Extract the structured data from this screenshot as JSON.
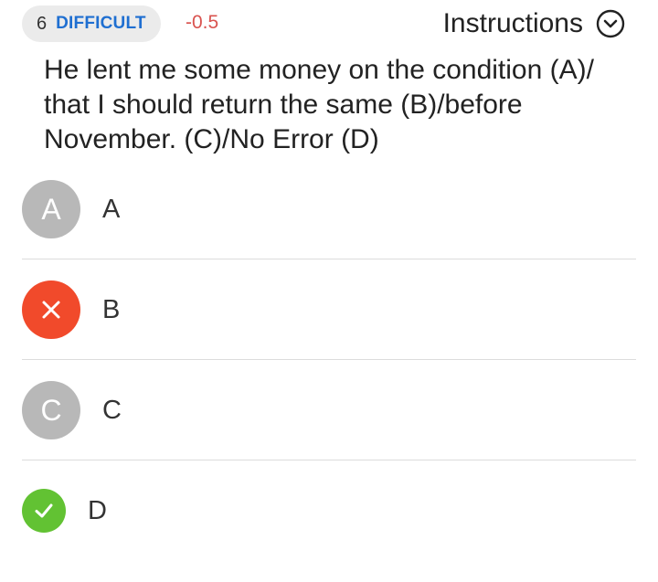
{
  "header": {
    "question_number": "6",
    "difficulty": "DIFFICULT",
    "penalty": "-0.5",
    "instructions_label": "Instructions"
  },
  "question": {
    "text": "He lent me some money on the condition (A)/ that I should return the same (B)/before November. (C)/No Error (D)"
  },
  "options": [
    {
      "badge": "A",
      "label": "A",
      "state": "unselected",
      "icon": "letter"
    },
    {
      "badge": "",
      "label": "B",
      "state": "wrong",
      "icon": "close-icon"
    },
    {
      "badge": "C",
      "label": "C",
      "state": "unselected",
      "icon": "letter"
    },
    {
      "badge": "",
      "label": "D",
      "state": "correct",
      "icon": "check-icon"
    }
  ],
  "colors": {
    "difficulty": "#1f6fd1",
    "penalty": "#d9534f",
    "wrong": "#f14a2b",
    "correct": "#62c233",
    "neutral_badge": "#b8b8b8"
  }
}
